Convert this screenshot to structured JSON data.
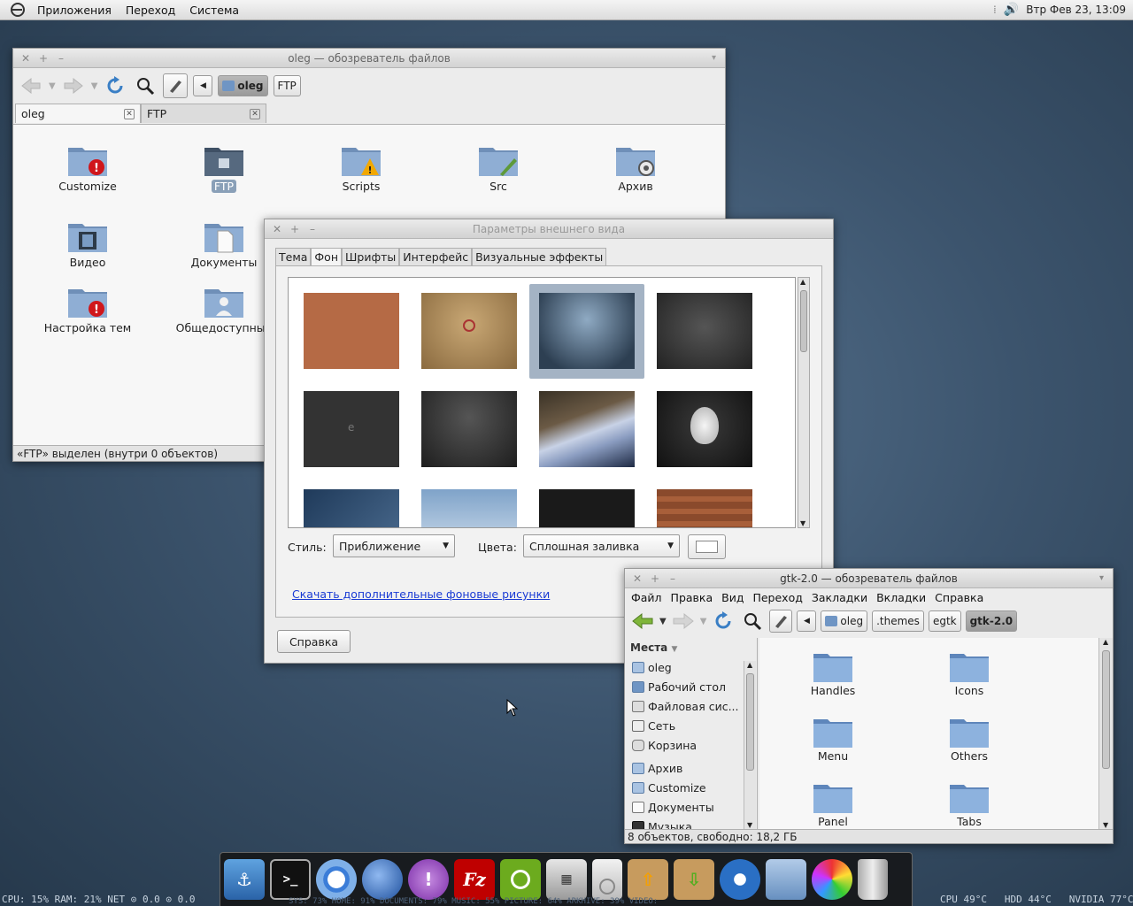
{
  "top_panel": {
    "menus": [
      "Приложения",
      "Переход",
      "Система"
    ],
    "clock": "Втр Фев 23, 13:09",
    "tray_icons": [
      "handle-icon",
      "volume-icon"
    ]
  },
  "file_manager_home": {
    "title": "oleg — обозреватель файлов",
    "breadcrumbs": [
      "oleg",
      "FTP"
    ],
    "tabs": [
      {
        "label": "oleg"
      },
      {
        "label": "FTP"
      }
    ],
    "items": [
      {
        "label": "Customize",
        "icon": "folder-error-icon"
      },
      {
        "label": "FTP",
        "icon": "folder-ftp-icon"
      },
      {
        "label": "Scripts",
        "icon": "folder-warning-icon"
      },
      {
        "label": "Src",
        "icon": "folder-src-icon"
      },
      {
        "label": "Архив",
        "icon": "folder-archive-icon"
      },
      {
        "label": "Видео",
        "icon": "folder-video-icon"
      },
      {
        "label": "Документы",
        "icon": "folder-documents-icon"
      },
      {
        "label": "Настройка тем",
        "icon": "folder-error-icon"
      },
      {
        "label": "Общедоступные",
        "icon": "folder-public-icon"
      }
    ],
    "status": "«FTP» выделен (внутри 0 объектов)"
  },
  "appearance_dialog": {
    "title": "Параметры внешнего вида",
    "tabs": [
      "Тема",
      "Фон",
      "Шрифты",
      "Интерфейс",
      "Визуальные эффекты"
    ],
    "selected_tab": "Фон",
    "style_label": "Стиль:",
    "style_value": "Приближение",
    "colors_label": "Цвета:",
    "colors_value": "Сплошная заливка",
    "download_link": "Скачать дополнительные фоновые рисунки",
    "help_button": "Справка"
  },
  "file_manager_gtk": {
    "title": "gtk-2.0 — обозреватель файлов",
    "menus": [
      "Файл",
      "Правка",
      "Вид",
      "Переход",
      "Закладки",
      "Вкладки",
      "Справка"
    ],
    "breadcrumbs": [
      "oleg",
      ".themes",
      "egtk",
      "gtk-2.0"
    ],
    "places_header": "Места",
    "places": [
      "oleg",
      "Рабочий стол",
      "Файловая сис...",
      "Сеть",
      "Корзина",
      "Архив",
      "Customize",
      "Документы",
      "Музыка"
    ],
    "items": [
      "Handles",
      "Icons",
      "Menu",
      "Others",
      "Panel",
      "Tabs"
    ],
    "status": "8 объектов, свободно: 18,2 ГБ"
  },
  "dock": {
    "icons": [
      "anchor-icon",
      "terminal-icon",
      "chromium-icon",
      "thunderbird-icon",
      "pidgin-icon",
      "filezilla-icon",
      "ubuntu-tweak-icon",
      "calculator-icon",
      "ipod-icon",
      "upload-box-icon",
      "download-box-icon",
      "music-player-icon",
      "folder-icon",
      "paint-icon",
      "trash-icon"
    ]
  },
  "conky": {
    "left": "CPU: 15% RAM: 21% NET ⊙ 0.0 ⊙ 0.0",
    "middle": "SYS: 73% HOME: 91% DOCUMENTS: 79% MUSIC: 55% PICTURE: 64% ARKHIVE: 39% VIDEO:",
    "right": "CPU 49°C   HDD 44°C   NVIDIA 77°C"
  }
}
